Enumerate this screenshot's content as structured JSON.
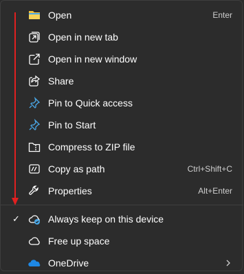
{
  "menu": {
    "items": [
      {
        "label": "Open",
        "shortcut": "Enter",
        "icon": "folder-icon"
      },
      {
        "label": "Open in new tab",
        "shortcut": "",
        "icon": "new-tab-icon"
      },
      {
        "label": "Open in new window",
        "shortcut": "",
        "icon": "new-window-icon"
      },
      {
        "label": "Share",
        "shortcut": "",
        "icon": "share-icon"
      },
      {
        "label": "Pin to Quick access",
        "shortcut": "",
        "icon": "pin-icon"
      },
      {
        "label": "Pin to Start",
        "shortcut": "",
        "icon": "pin-icon"
      },
      {
        "label": "Compress to ZIP file",
        "shortcut": "",
        "icon": "zip-folder-icon"
      },
      {
        "label": "Copy as path",
        "shortcut": "Ctrl+Shift+C",
        "icon": "copy-path-icon"
      },
      {
        "label": "Properties",
        "shortcut": "Alt+Enter",
        "icon": "wrench-icon"
      }
    ],
    "onedrive_items": [
      {
        "label": "Always keep on this device",
        "checked": true,
        "icon": "cloud-sync-icon"
      },
      {
        "label": "Free up space",
        "checked": false,
        "icon": "cloud-icon"
      },
      {
        "label": "OneDrive",
        "submenu": true,
        "icon": "onedrive-icon"
      }
    ],
    "check_glyph": "✓"
  },
  "colors": {
    "background": "#2c2c2c",
    "text": "#ffffff",
    "accent_blue": "#4aa8e8",
    "folder_yellow": "#f3c13a",
    "annotation_red": "#e02020"
  }
}
